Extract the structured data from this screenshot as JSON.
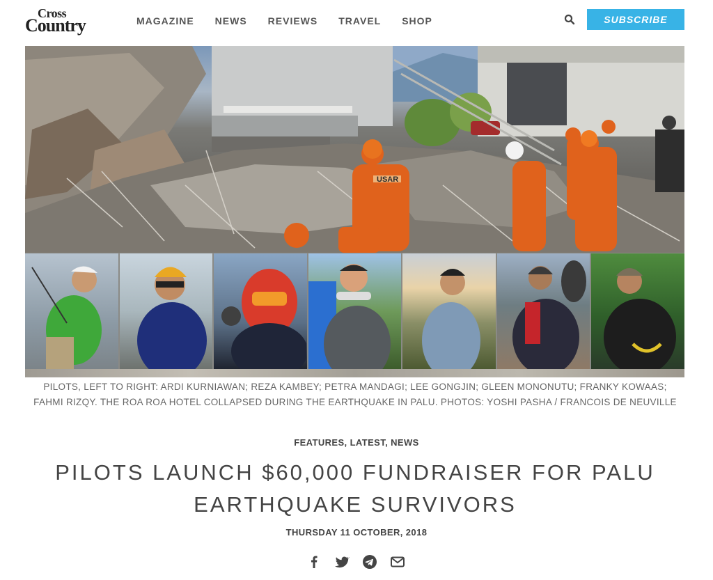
{
  "logo": {
    "line1": "Cross",
    "line2": "Country"
  },
  "nav": {
    "items": [
      {
        "label": "MAGAZINE"
      },
      {
        "label": "NEWS"
      },
      {
        "label": "REVIEWS"
      },
      {
        "label": "TRAVEL"
      },
      {
        "label": "SHOP"
      }
    ],
    "search_icon": "search-icon",
    "subscribe_label": "SUBSCRIBE"
  },
  "colors": {
    "accent": "#38b3e6",
    "text": "#444444",
    "caption": "#666666"
  },
  "hero": {
    "vest_text": "USAR",
    "photo_count": 7
  },
  "caption": "PILOTS, LEFT TO RIGHT: ARDI KURNIAWAN; REZA KAMBEY; PETRA MANDAGI; LEE GONGJIN; GLEEN MONONUTU; FRANKY KOWAAS; FAHMI RIZQY. THE ROA ROA HOTEL COLLAPSED DURING THE EARTHQUAKE IN PALU. PHOTOS: YOSHI PASHA / FRANCOIS DE NEUVILLE",
  "article": {
    "categories": "FEATURES, LATEST, NEWS",
    "title": "PILOTS LAUNCH $60,000 FUNDRAISER FOR PALU EARTHQUAKE SURVIVORS",
    "date": "THURSDAY 11 OCTOBER, 2018"
  },
  "share": {
    "icons": [
      "facebook-icon",
      "twitter-icon",
      "telegram-icon",
      "email-icon"
    ]
  }
}
